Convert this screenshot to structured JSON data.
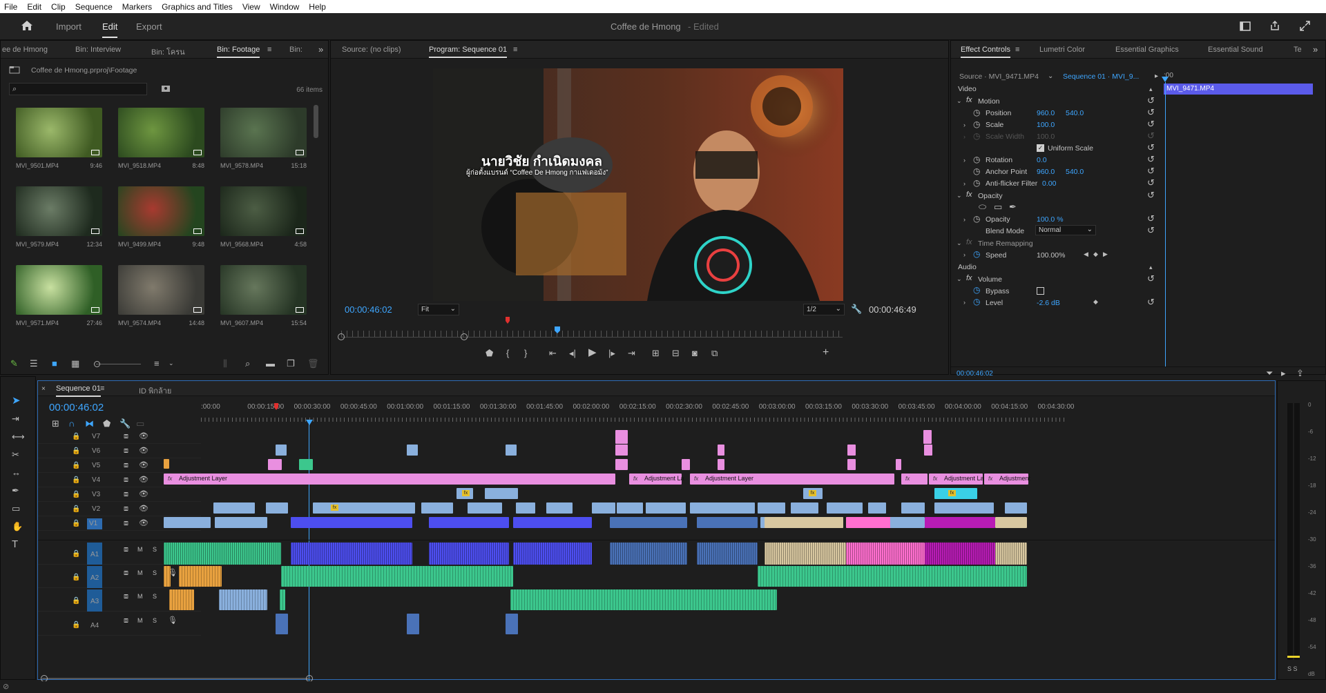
{
  "menubar": {
    "items": [
      "File",
      "Edit",
      "Clip",
      "Sequence",
      "Markers",
      "Graphics and Titles",
      "View",
      "Window",
      "Help"
    ]
  },
  "workspace": {
    "tabs": [
      "Import",
      "Edit",
      "Export"
    ],
    "active": "Edit",
    "title": "Coffee de Hmong",
    "edited": "- Edited"
  },
  "project": {
    "tabs": [
      "ee de Hmong",
      "Bin: Interview",
      "Bin: โครน",
      "Bin: Footage",
      "Bin:"
    ],
    "path": "Coffee de Hmong.prproj\\Footage",
    "count": "66 items",
    "items": [
      {
        "name": "MVI_9501.MP4",
        "dur": "9:46",
        "c1": "#3f5a22",
        "c2": "#9bb86a"
      },
      {
        "name": "MVI_9518.MP4",
        "dur": "8:48",
        "c1": "#2c4a1f",
        "c2": "#6e9640"
      },
      {
        "name": "MVI_9578.MP4",
        "dur": "15:18",
        "c1": "#2d3b2a",
        "c2": "#5a7450"
      },
      {
        "name": "MVI_9579.MP4",
        "dur": "12:34",
        "c1": "#1e2a1e",
        "c2": "#6b7c66"
      },
      {
        "name": "MVI_9499.MP4",
        "dur": "9:48",
        "c1": "#24451f",
        "c2": "#a83a30"
      },
      {
        "name": "MVI_9568.MP4",
        "dur": "4:58",
        "c1": "#1b261a",
        "c2": "#4c5d44"
      },
      {
        "name": "MVI_9571.MP4",
        "dur": "27:46",
        "c1": "#2f5f26",
        "c2": "#c8e0a0"
      },
      {
        "name": "MVI_9574.MP4",
        "dur": "14:48",
        "c1": "#3a3a36",
        "c2": "#807a6c"
      },
      {
        "name": "MVI_9607.MP4",
        "dur": "15:54",
        "c1": "#253424",
        "c2": "#66775c"
      }
    ]
  },
  "program": {
    "source_tab": "Source: (no clips)",
    "tab": "Program: Sequence 01",
    "timecode": "00:00:46:02",
    "fit": "Fit",
    "resolution": "1/2",
    "duration": "00:00:46:49",
    "subtitle_name": "นายวิชัย กำเนิดมงคล",
    "subtitle_sub": "ผู้ก่อตั้งแบรนด์ “Coffee De Hmong กาแฟเดอม้ง”"
  },
  "effects": {
    "tabs": [
      "Effect Controls",
      "Lumetri Color",
      "Essential Graphics",
      "Essential Sound",
      "Te"
    ],
    "source": "Source · MVI_9471.MP4",
    "target": "Sequence 01 · MVI_9...",
    "clipname": "MVI_9471.MP4",
    "ruler_time": ":00",
    "video_label": "Video",
    "audio_label": "Audio",
    "motion": "Motion",
    "position": {
      "label": "Position",
      "x": "960.0",
      "y": "540.0"
    },
    "scale": {
      "label": "Scale",
      "v": "100.0"
    },
    "scale_width": {
      "label": "Scale Width",
      "v": "100.0"
    },
    "uniform": "Uniform Scale",
    "rotation": {
      "label": "Rotation",
      "v": "0.0"
    },
    "anchor": {
      "label": "Anchor Point",
      "x": "960.0",
      "y": "540.0"
    },
    "flicker": {
      "label": "Anti-flicker Filter",
      "v": "0.00"
    },
    "opacity_group": "Opacity",
    "opacity": {
      "label": "Opacity",
      "v": "100.0 %"
    },
    "blend": {
      "label": "Blend Mode",
      "v": "Normal"
    },
    "remap": "Time Remapping",
    "speed": {
      "label": "Speed",
      "v": "100.00%"
    },
    "volume": "Volume",
    "bypass": "Bypass",
    "level": {
      "label": "Level",
      "v": "-2.6 dB"
    },
    "footer_time": "00:00:46:02"
  },
  "timeline": {
    "tab": "Sequence 01",
    "tab2": "ID พิกล้าย",
    "timecode": "00:00:46:02",
    "ruler": [
      ":00:00",
      "00:00:15:00",
      "00:00:30:00",
      "00:00:45:00",
      "00:01:00:00",
      "00:01:15:00",
      "00:01:30:00",
      "00:01:45:00",
      "00:02:00:00",
      "00:02:15:00",
      "00:02:30:00",
      "00:02:45:00",
      "00:03:00:00",
      "00:03:15:00",
      "00:03:30:00",
      "00:03:45:00",
      "00:04:00:00",
      "00:04:15:00",
      "00:04:30:00"
    ],
    "video_tracks": [
      "V7",
      "V6",
      "V5",
      "V4",
      "V3",
      "V2",
      "V1"
    ],
    "audio_tracks": [
      "A1",
      "A2",
      "A3",
      "A4"
    ],
    "adj1": "Adjustment Layer",
    "adj2": "Adjustment La",
    "adj3": "Adjustment Layer",
    "adj4": "Adjustment Laye",
    "adj5": "Adjustment"
  },
  "meter": {
    "ticks": [
      "0",
      "-6",
      "-12",
      "-18",
      "-24",
      "-30",
      "-36",
      "-42",
      "-48",
      "-54",
      "dB"
    ],
    "solo": "S S"
  }
}
